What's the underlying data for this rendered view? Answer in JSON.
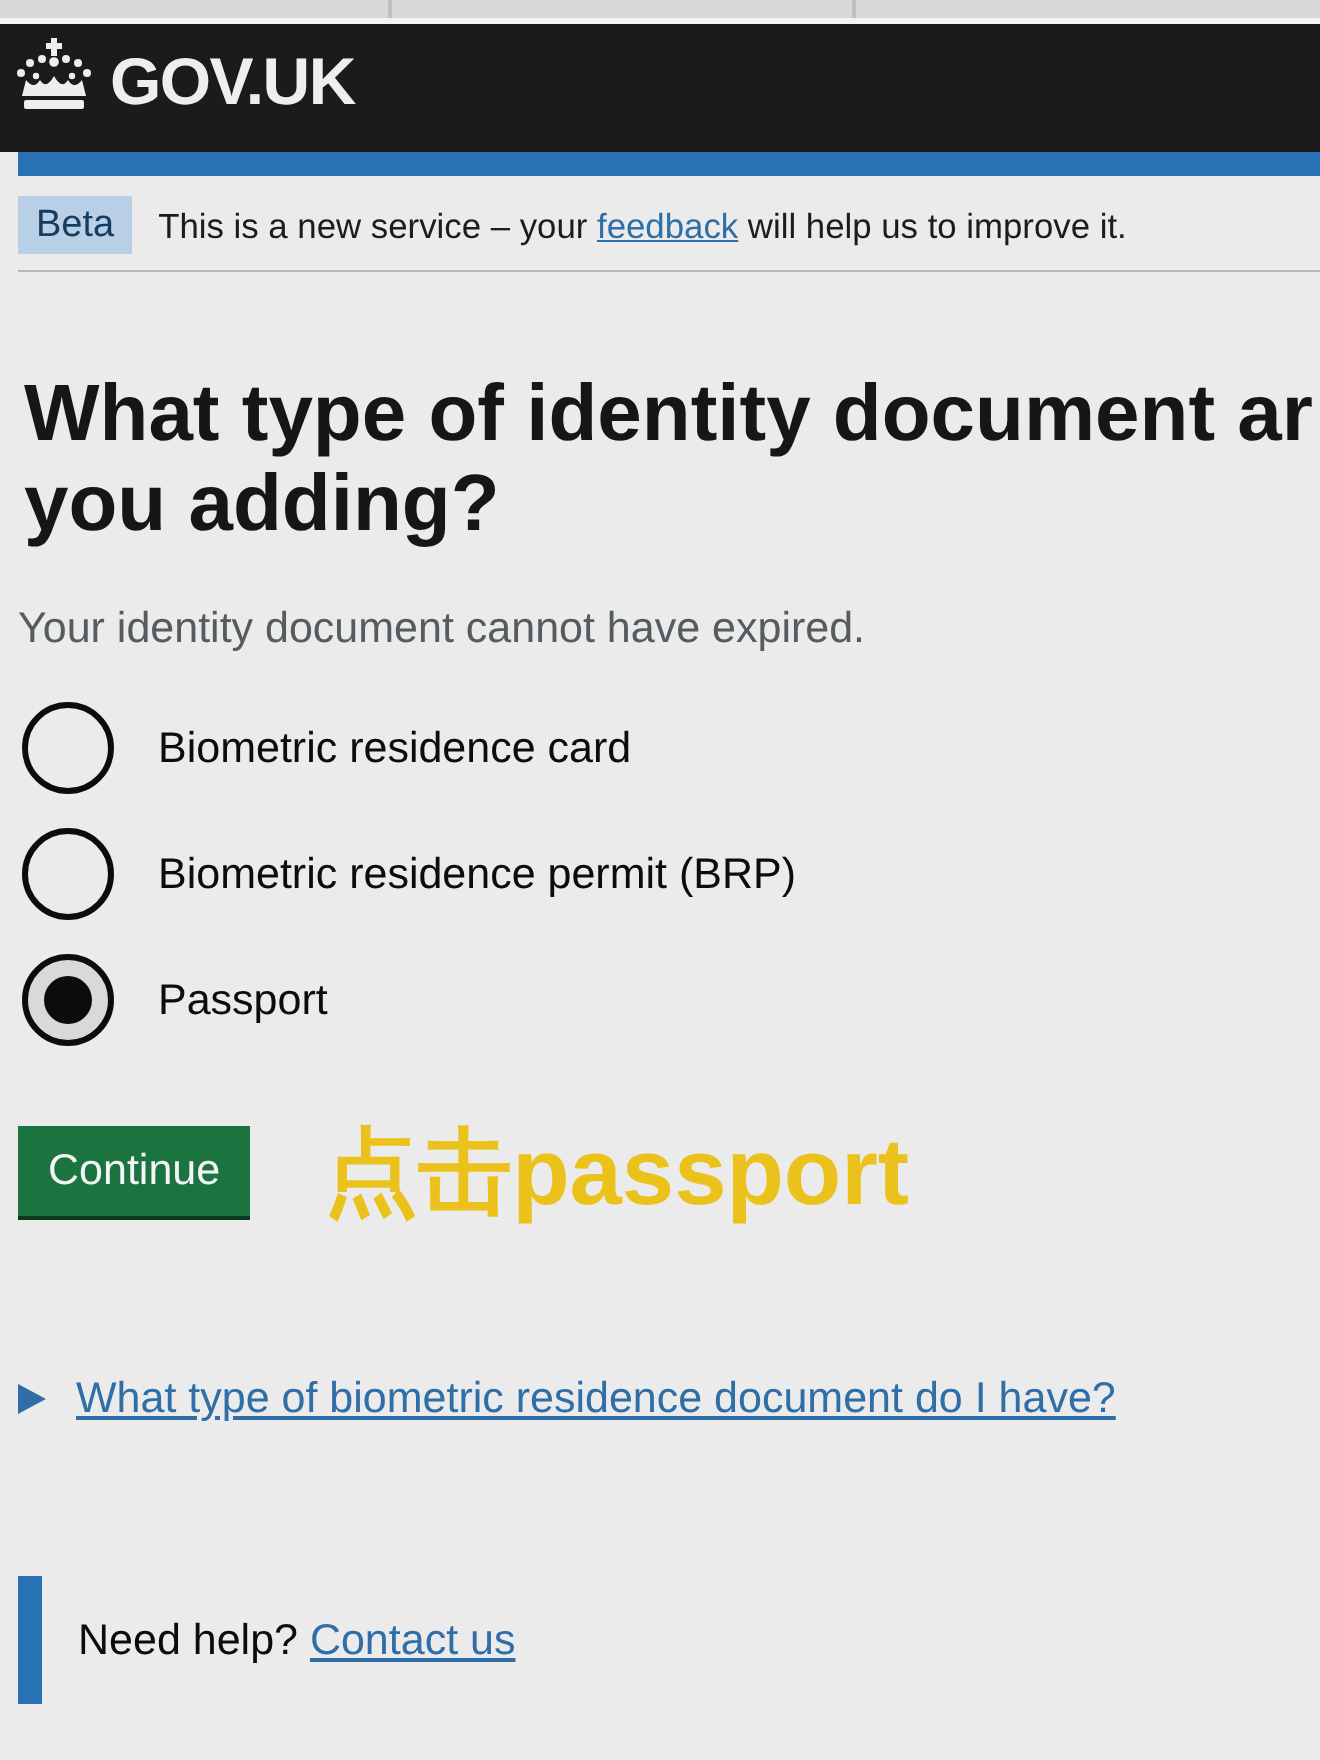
{
  "header": {
    "logo_text": "GOV.UK"
  },
  "phase_banner": {
    "tag": "Beta",
    "text_before": "This is a new service – your",
    "link": "feedback",
    "text_after": "will help us to improve it."
  },
  "heading_lines": [
    "What type of identity document ar",
    "you adding?"
  ],
  "hint": "Your identity document cannot have expired.",
  "options": [
    {
      "label": "Biometric residence card",
      "selected": false
    },
    {
      "label": "Biometric residence permit (BRP)",
      "selected": false
    },
    {
      "label": "Passport",
      "selected": true
    }
  ],
  "continue_button": {
    "label": "Continue"
  },
  "annotation": {
    "text": "点击passport"
  },
  "details": {
    "summary": "What type of biometric residence document do I have?",
    "expanded": false
  },
  "help": {
    "text": "Need help?",
    "link": "Contact us"
  }
}
